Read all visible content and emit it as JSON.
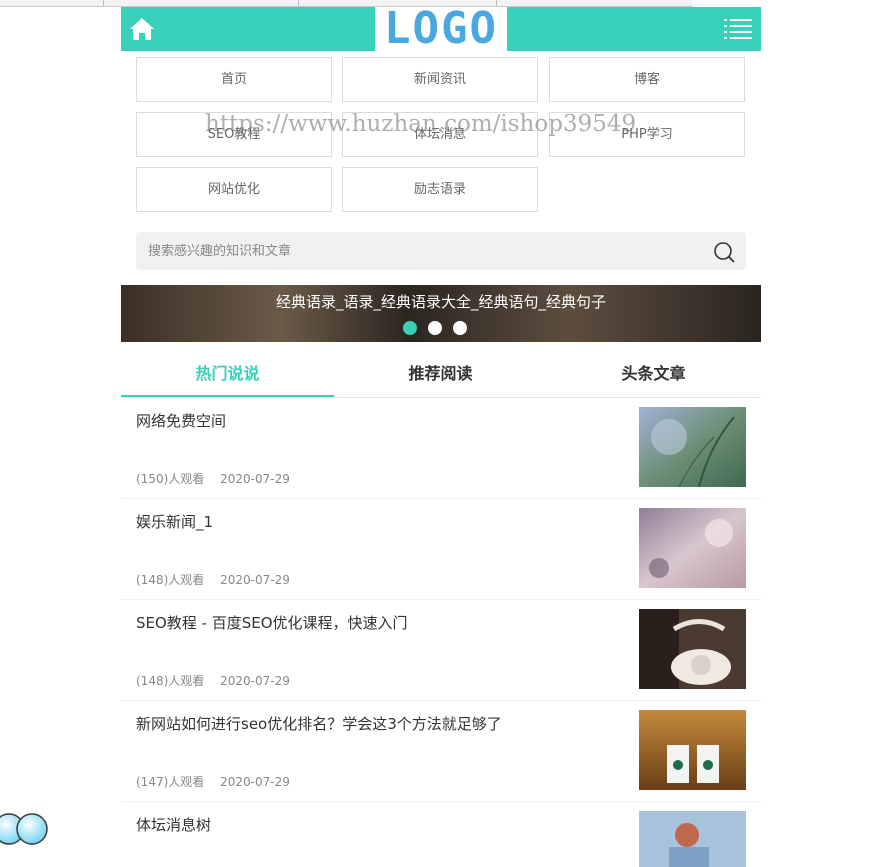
{
  "header": {
    "logo": "LOGO",
    "accent_color": "#38d0b8",
    "logo_color": "#4aa8e0",
    "home_icon": "home-icon",
    "menu_icon": "list-menu-icon"
  },
  "nav": {
    "items": [
      {
        "label": "首页"
      },
      {
        "label": "新闻资讯"
      },
      {
        "label": "博客"
      },
      {
        "label": "SEO教程"
      },
      {
        "label": "体坛消息"
      },
      {
        "label": "PHP学习"
      },
      {
        "label": "网站优化"
      },
      {
        "label": "励志语录"
      }
    ]
  },
  "watermark": "https://www.huzhan.com/ishop39549",
  "search": {
    "placeholder": "搜索感兴趣的知识和文章",
    "icon": "search-icon"
  },
  "banner": {
    "title": "经典语录_语录_经典语录大全_经典语句_经典句子",
    "dots_total": 3,
    "active_dot": 1
  },
  "tabs": [
    {
      "label": "热门说说",
      "active": true
    },
    {
      "label": "推荐阅读",
      "active": false
    },
    {
      "label": "头条文章",
      "active": false
    }
  ],
  "articles": [
    {
      "title": "网络免费空间",
      "views": "(150)人观看",
      "date": "2020-07-29"
    },
    {
      "title": "娱乐新闻_1",
      "views": "(148)人观看",
      "date": "2020-07-29"
    },
    {
      "title": "SEO教程 - 百度SEO优化课程，快速入门",
      "views": "(148)人观看",
      "date": "2020-07-29"
    },
    {
      "title": "新网站如何进行seo优化排名？学会这3个方法就足够了",
      "views": "(147)人观看",
      "date": "2020-07-29"
    },
    {
      "title": "体坛消息树",
      "views": "",
      "date": ""
    }
  ]
}
